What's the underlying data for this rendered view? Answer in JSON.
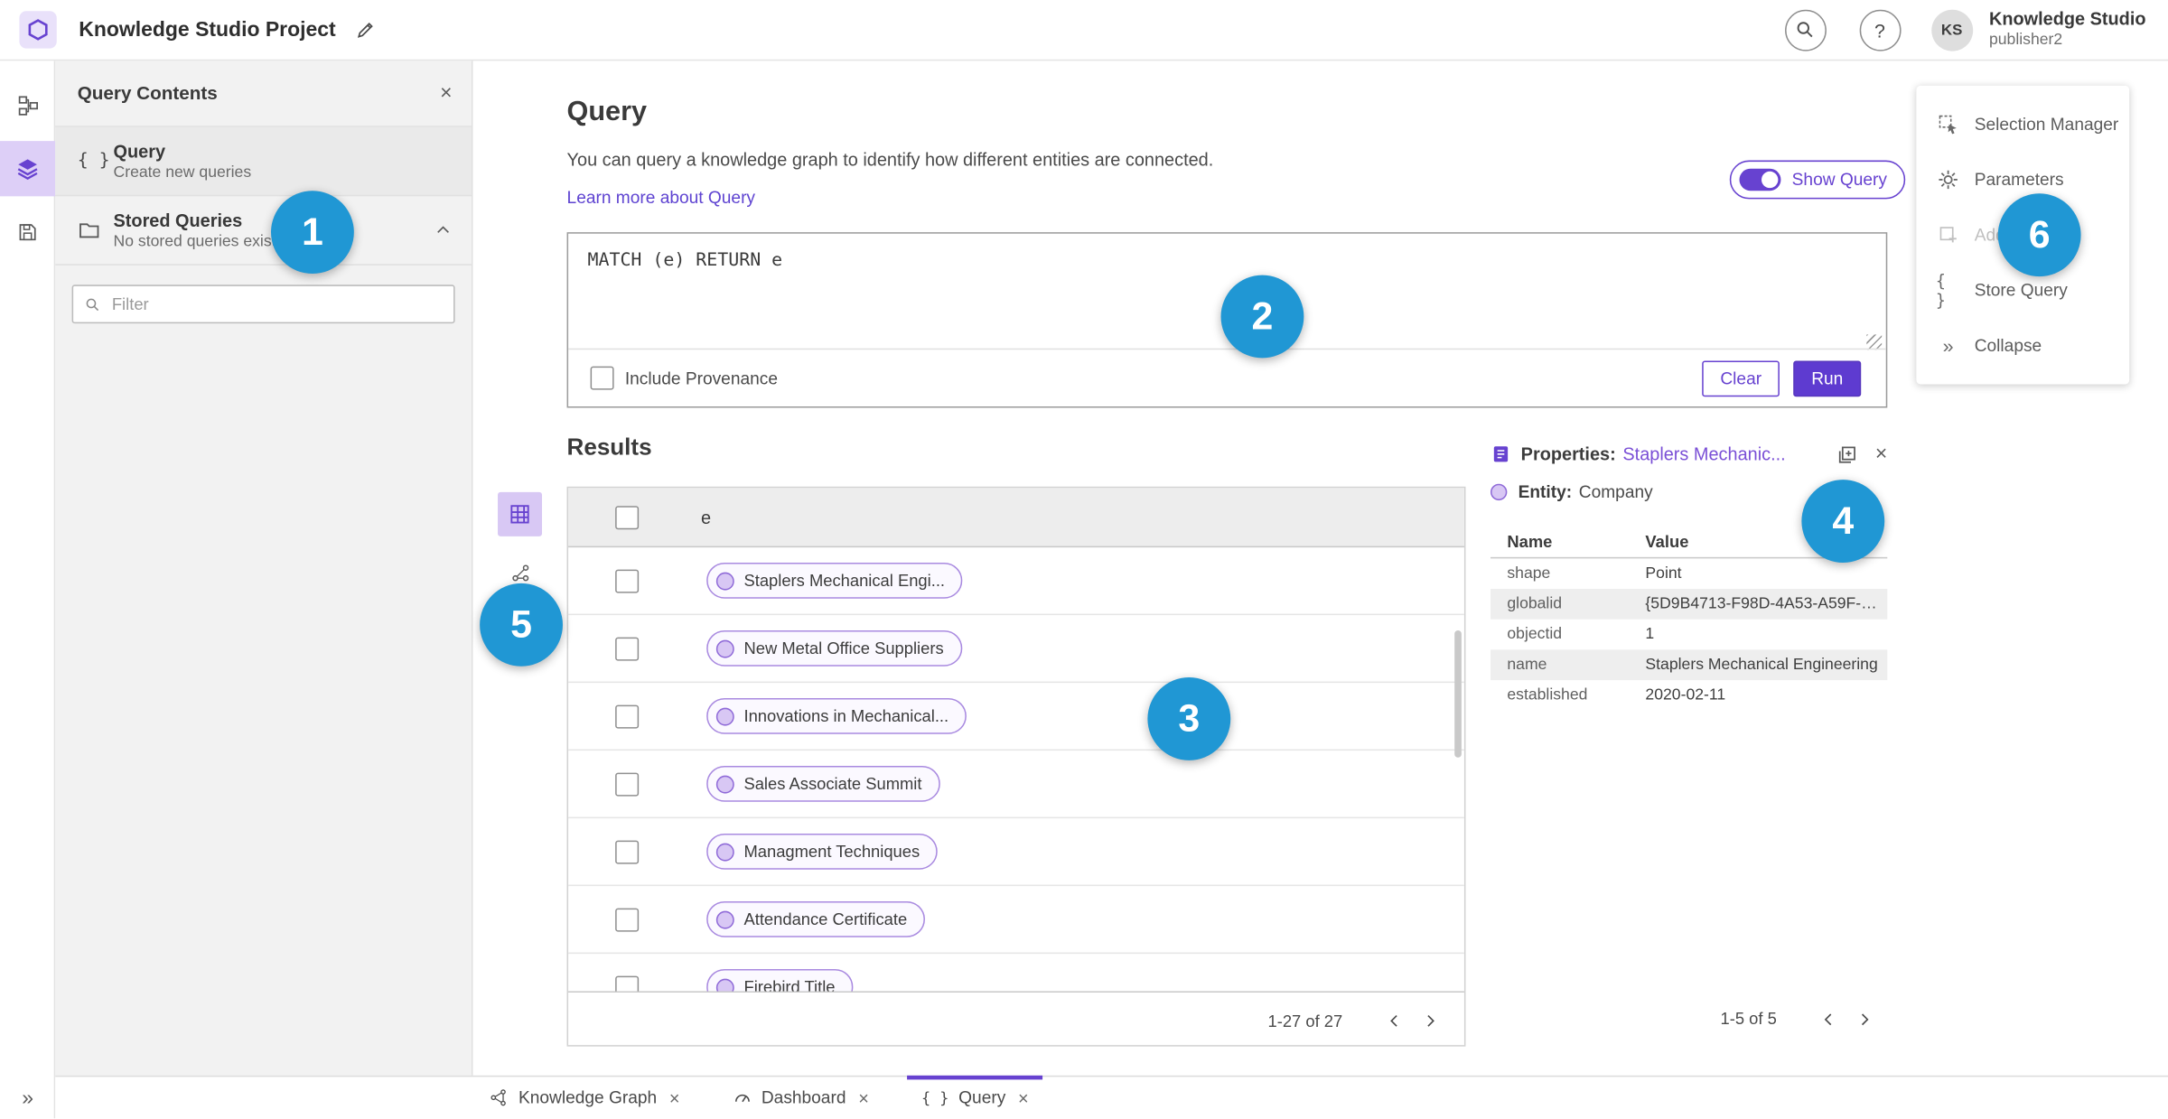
{
  "header": {
    "title": "Knowledge Studio Project",
    "account_name": "Knowledge Studio",
    "account_user": "publisher2",
    "avatar_initials": "KS"
  },
  "left_panel": {
    "title": "Query Contents",
    "query_item": {
      "label": "Query",
      "sublabel": "Create new queries"
    },
    "stored_item": {
      "label": "Stored Queries",
      "sublabel": "No stored queries exist"
    },
    "filter_placeholder": "Filter"
  },
  "query_section": {
    "title": "Query",
    "description": "You can query a knowledge graph to identify how different entities are connected.",
    "learn_more": "Learn more about Query",
    "show_query_label": "Show Query",
    "query_text": "MATCH (e) RETURN e",
    "include_provenance": "Include Provenance",
    "clear_label": "Clear",
    "run_label": "Run"
  },
  "results": {
    "title": "Results",
    "column_e": "e",
    "rows": [
      "Staplers Mechanical Engi...",
      "New Metal Office Suppliers",
      "Innovations in Mechanical...",
      "Sales Associate Summit",
      "Managment Techniques",
      "Attendance Certificate",
      "Firebird Title"
    ],
    "pagination": "1-27 of 27"
  },
  "properties_panel": {
    "label": "Properties:",
    "link": "Staplers Mechanic...",
    "entity_label": "Entity:",
    "entity_value": "Company",
    "col_name": "Name",
    "col_value": "Value",
    "rows": [
      {
        "name": "shape",
        "value": "Point"
      },
      {
        "name": "globalid",
        "value": "{5D9B4713-F98D-4A53-A59F-C11..."
      },
      {
        "name": "objectid",
        "value": "1"
      },
      {
        "name": "name",
        "value": "Staplers Mechanical Engineering"
      },
      {
        "name": "established",
        "value": "2020-02-11"
      }
    ],
    "pagination": "1-5 of 5"
  },
  "right_menu": {
    "items": [
      "Selection Manager",
      "Parameters",
      "Add To Map",
      "Store Query",
      "Collapse"
    ]
  },
  "bottom_tabs": [
    {
      "label": "Knowledge Graph"
    },
    {
      "label": "Dashboard"
    },
    {
      "label": "Query"
    }
  ],
  "annotations": [
    "1",
    "2",
    "3",
    "4",
    "5",
    "6"
  ],
  "icons": {
    "close": "×",
    "braces": "{ }",
    "question": "?",
    "collapse_chevrons": "»"
  },
  "colors": {
    "accent": "#6742d0",
    "annotation_badge": "#2097d4",
    "chip_border": "#a98ae0",
    "chip_dot": "#d8c7f4"
  }
}
